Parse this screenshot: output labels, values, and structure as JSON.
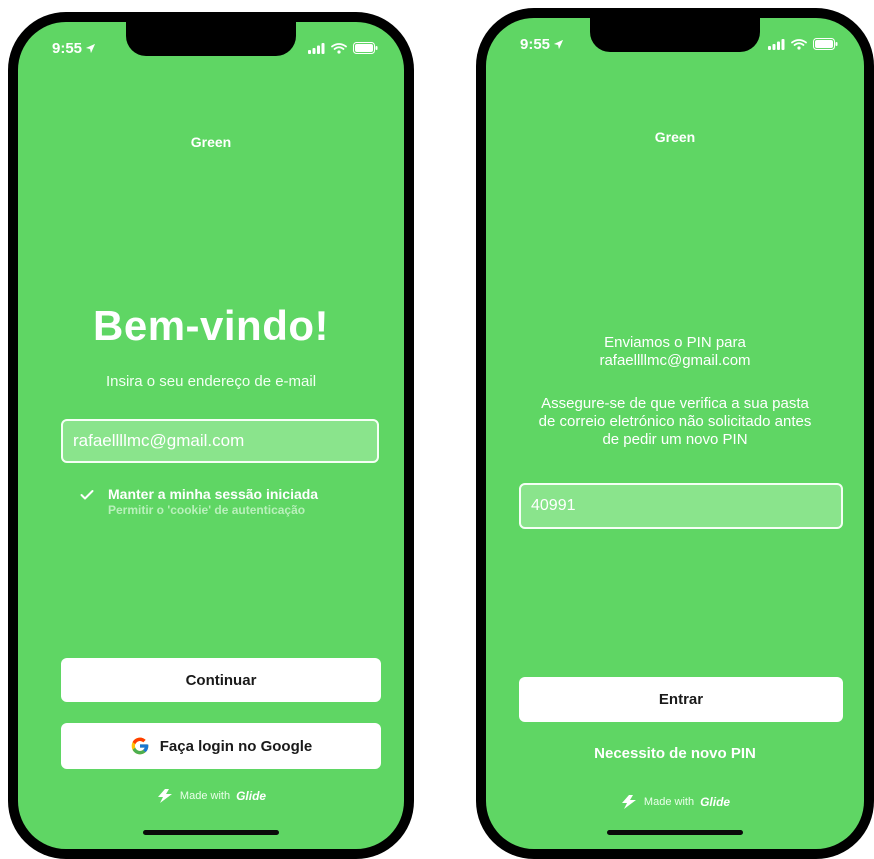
{
  "status_bar": {
    "time": "9:55"
  },
  "login_screen": {
    "app_title": "Green",
    "welcome": "Bem-vindo!",
    "subtitle": "Insira o seu endereço de e-mail",
    "email_value": "rafaellllmc@gmail.com",
    "keep_session_label": "Manter a minha sessão iniciada",
    "keep_session_sublabel": "Permitir o 'cookie' de autenticação",
    "keep_session_checked": true,
    "continue_label": "Continuar",
    "google_label": "Faça login no Google",
    "made_with_prefix": "Made with",
    "made_with_brand": "Glide"
  },
  "pin_screen": {
    "app_title": "Green",
    "sent_line1": "Enviamos o PIN para",
    "sent_line2": "rafaellllmc@gmail.com",
    "notice_line1": "Assegure-se de que verifica a sua pasta",
    "notice_line2": "de correio eletrónico não solicitado antes",
    "notice_line3": "de pedir um novo PIN",
    "pin_value": "40991",
    "enter_label": "Entrar",
    "new_pin_label": "Necessito de novo PIN",
    "made_with_prefix": "Made with",
    "made_with_brand": "Glide"
  },
  "colors": {
    "screen_bg": "#5fd664",
    "input_bg": "#8ae48c",
    "button_bg": "#ffffff",
    "text": "#ffffff"
  },
  "icons": [
    "location-arrow-icon",
    "signal-icon",
    "wifi-icon",
    "battery-icon",
    "checkmark-icon",
    "google-logo-icon",
    "glide-logo-icon"
  ]
}
